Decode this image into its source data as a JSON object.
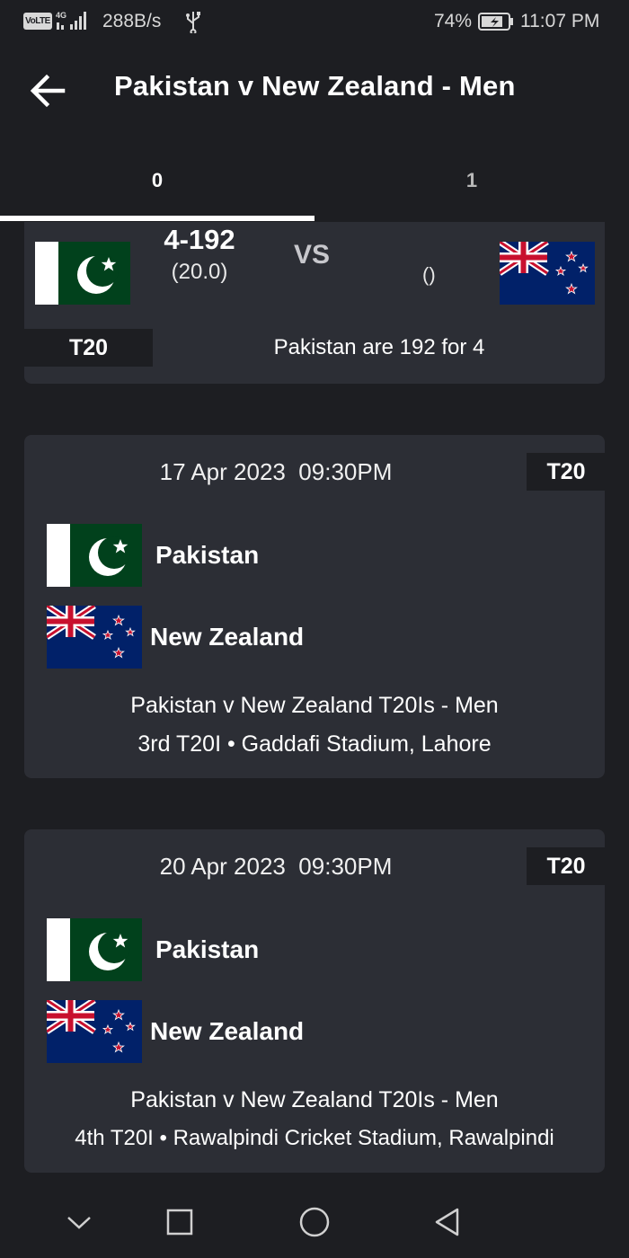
{
  "status_bar": {
    "volte": "VoLTE",
    "network_type": "4G",
    "net_speed": "288B/s",
    "battery_pct": "74%",
    "time": "11:07 PM"
  },
  "app_bar": {
    "title": "Pakistan v New Zealand - Men",
    "back_icon": "arrow-left-icon"
  },
  "tabs": [
    {
      "label": "0",
      "active": true
    },
    {
      "label": "1",
      "active": false
    }
  ],
  "live_match": {
    "home_flag": "pakistan-flag",
    "away_flag": "new-zealand-flag",
    "home_score": "4-192",
    "home_overs": "(20.0)",
    "vs": "VS",
    "away_score": "()",
    "format": "T20",
    "summary": "Pakistan are 192 for 4"
  },
  "fixtures": [
    {
      "date": "17 Apr 2023  09:30PM",
      "format": "T20",
      "home_team": "Pakistan",
      "away_team": "New Zealand",
      "series": "Pakistan v New Zealand T20Is - Men",
      "match_info": "3rd T20I • Gaddafi Stadium, Lahore"
    },
    {
      "date": "20 Apr 2023  09:30PM",
      "format": "T20",
      "home_team": "Pakistan",
      "away_team": "New Zealand",
      "series": "Pakistan v New Zealand T20Is - Men",
      "match_info": "4th T20I • Rawalpindi Cricket Stadium, Rawalpindi"
    }
  ],
  "nav_bar": {
    "icons": [
      "chevron-down-icon",
      "square-recents-icon",
      "circle-home-icon",
      "triangle-back-icon"
    ]
  },
  "colors": {
    "background": "#1d1e22",
    "card": "#2c2e35",
    "badge": "#1d1e22",
    "pakistan_green": "#01411c",
    "nz_blue": "#012169",
    "nz_red": "#c8102e"
  }
}
